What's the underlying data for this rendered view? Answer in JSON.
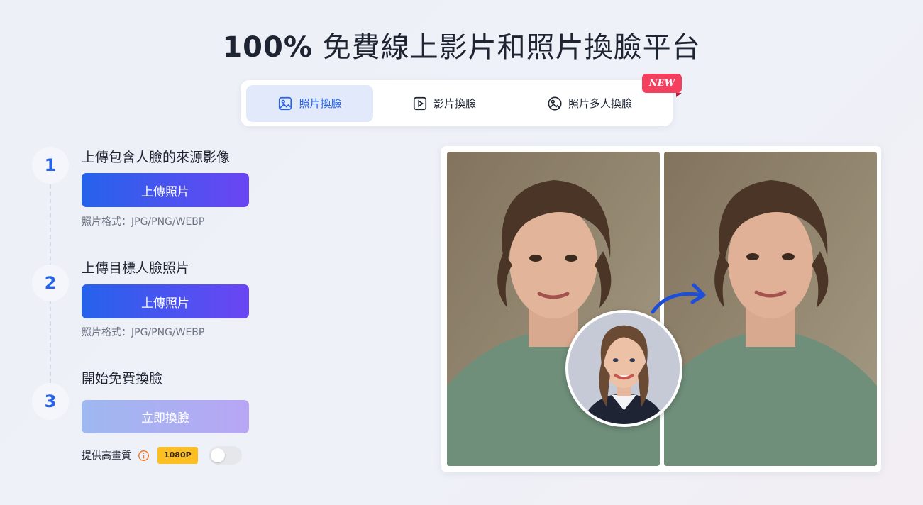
{
  "page": {
    "title_bold": "100%",
    "title_rest": " 免費線上影片和照片換臉平台"
  },
  "tabs": [
    {
      "label": "照片換臉",
      "icon": "image-icon",
      "active": true
    },
    {
      "label": "影片換臉",
      "icon": "play-icon",
      "active": false
    },
    {
      "label": "照片多人換臉",
      "icon": "multi-face-image-icon",
      "active": false
    }
  ],
  "new_badge": "NEW",
  "steps": [
    {
      "number": "1",
      "title": "上傳包含人臉的來源影像",
      "button": "上傳照片",
      "note": "照片格式：JPG/PNG/WEBP"
    },
    {
      "number": "2",
      "title": "上傳目標人臉照片",
      "button": "上傳照片",
      "note": "照片格式：JPG/PNG/WEBP"
    },
    {
      "number": "3",
      "title": "開始免費換臉",
      "button": "立即換臉"
    }
  ],
  "hq": {
    "label": "提供高畫質",
    "badge": "1080P",
    "enabled": false
  },
  "colors": {
    "accent": "#2563eb",
    "accent_gradient_end": "#6b45f3",
    "new_badge": "#f43f5e",
    "res_badge": "#fbbf24",
    "info_icon": "#f97316"
  }
}
